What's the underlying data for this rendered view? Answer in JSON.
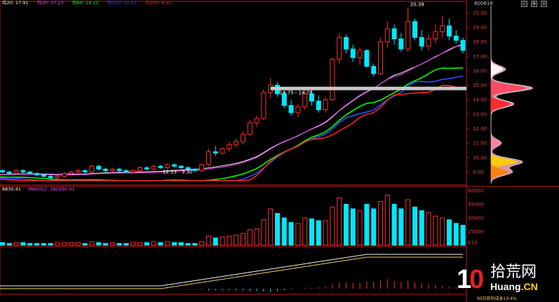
{
  "stock_code": "600618",
  "cost_label": "90日获利成本19.4%",
  "watermark": {
    "num_left": "1",
    "num_right": "0",
    "cn": "拾荒网",
    "url_main": "Huang",
    "url_suffix": ".CN"
  },
  "toolbar_icons": [
    "search-icon",
    "settings-icon",
    "close-icon"
  ],
  "colors": {
    "up": "#ff3030",
    "down": "#00e8ff",
    "grid": "#5a0000",
    "axis": "#c01818"
  },
  "price_panel": {
    "ma_legend": [
      {
        "label": "均20: 17.91",
        "color": "#f0f0f0"
      },
      {
        "label": "均30: 17.23",
        "color": "#ff40ff"
      },
      {
        "label": "均60: 14.12",
        "color": "#00ff00"
      },
      {
        "label": "均120: 11.11",
        "color": "#3050ff"
      },
      {
        "label": "均200: 9.91",
        "color": "#ff2020"
      }
    ],
    "y_ticks": [
      "20.00",
      "19.00",
      "18.00",
      "17.00",
      "16.00",
      "15.00",
      "14.00",
      "13.00",
      "12.00",
      "11.00",
      "10.00",
      "9.00"
    ],
    "annotations": [
      {
        "text": "20.39",
        "price": 20.39
      },
      {
        "text": "14.75 - 14.76",
        "price": 14.75
      },
      {
        "text": "12.13 - 9.30",
        "price": 9.3
      }
    ]
  },
  "volume_panel": {
    "legend": [
      {
        "label": "8830.41",
        "color": "#ffffff"
      },
      {
        "label": "MAVOL2: 280290.41",
        "color": "#ff40ff"
      }
    ],
    "y_ticks": [
      "60000",
      "45000",
      "30000",
      "15000",
      "X10"
    ]
  },
  "chart_data": {
    "type": "candlestick",
    "ylim": [
      8.2,
      20.5
    ],
    "candles": [
      [
        8.6,
        8.9,
        8.5,
        8.8
      ],
      [
        8.8,
        8.9,
        8.6,
        8.7
      ],
      [
        8.7,
        8.8,
        8.5,
        8.6
      ],
      [
        8.6,
        8.9,
        8.5,
        8.8
      ],
      [
        8.8,
        8.9,
        8.6,
        8.7
      ],
      [
        8.7,
        9.0,
        8.6,
        8.9
      ],
      [
        8.9,
        9.3,
        8.8,
        9.1
      ],
      [
        9.1,
        9.2,
        8.9,
        9.0
      ],
      [
        9.0,
        9.1,
        8.8,
        8.9
      ],
      [
        8.9,
        9.2,
        8.8,
        9.1
      ],
      [
        9.1,
        9.2,
        8.9,
        9.0
      ],
      [
        9.0,
        9.1,
        8.8,
        8.9
      ],
      [
        8.9,
        9.0,
        8.7,
        8.8
      ],
      [
        8.8,
        8.9,
        8.6,
        8.7
      ],
      [
        8.7,
        8.8,
        8.5,
        8.6
      ],
      [
        8.6,
        8.8,
        8.5,
        8.7
      ],
      [
        8.7,
        9.0,
        8.6,
        8.9
      ],
      [
        8.9,
        9.1,
        8.8,
        9.0
      ],
      [
        9.0,
        9.2,
        8.9,
        9.1
      ],
      [
        9.1,
        9.2,
        8.9,
        9.0
      ],
      [
        9.0,
        9.5,
        8.9,
        9.4
      ],
      [
        9.4,
        9.5,
        9.1,
        9.2
      ],
      [
        9.2,
        9.3,
        9.0,
        9.1
      ],
      [
        9.1,
        9.3,
        9.0,
        9.2
      ],
      [
        9.2,
        9.3,
        9.0,
        9.1
      ],
      [
        9.1,
        9.2,
        8.9,
        9.0
      ],
      [
        9.0,
        9.2,
        8.9,
        9.1
      ],
      [
        9.1,
        9.4,
        9.0,
        9.3
      ],
      [
        9.3,
        9.4,
        9.1,
        9.2
      ],
      [
        9.2,
        9.5,
        9.1,
        9.4
      ],
      [
        9.4,
        9.5,
        9.2,
        9.3
      ],
      [
        9.3,
        9.6,
        9.2,
        9.5
      ],
      [
        9.5,
        9.6,
        9.3,
        9.4
      ],
      [
        9.4,
        9.5,
        9.2,
        9.3
      ],
      [
        9.3,
        9.4,
        9.1,
        9.2
      ],
      [
        9.2,
        9.3,
        9.0,
        9.1
      ],
      [
        9.1,
        9.6,
        9.0,
        9.5
      ],
      [
        9.5,
        10.6,
        9.4,
        10.4
      ],
      [
        10.4,
        10.8,
        10.1,
        10.3
      ],
      [
        10.3,
        10.7,
        10.2,
        10.6
      ],
      [
        10.6,
        11.1,
        10.4,
        10.9
      ],
      [
        10.9,
        11.3,
        10.7,
        11.1
      ],
      [
        11.1,
        11.8,
        10.9,
        11.6
      ],
      [
        11.6,
        12.6,
        11.5,
        12.4
      ],
      [
        12.4,
        12.9,
        12.1,
        12.7
      ],
      [
        12.7,
        14.7,
        12.6,
        14.5
      ],
      [
        14.5,
        15.5,
        14.1,
        15.0
      ],
      [
        15.0,
        15.2,
        14.2,
        14.4
      ],
      [
        14.4,
        14.6,
        13.4,
        13.6
      ],
      [
        13.6,
        14.0,
        12.9,
        13.1
      ],
      [
        13.1,
        13.7,
        12.8,
        13.5
      ],
      [
        13.5,
        14.7,
        13.3,
        14.4
      ],
      [
        14.4,
        14.8,
        13.6,
        13.9
      ],
      [
        13.9,
        14.3,
        13.1,
        13.3
      ],
      [
        13.3,
        14.2,
        13.1,
        14.0
      ],
      [
        14.0,
        16.9,
        13.9,
        16.8
      ],
      [
        16.8,
        18.6,
        16.5,
        18.3
      ],
      [
        18.3,
        18.5,
        17.2,
        17.5
      ],
      [
        17.5,
        17.8,
        16.6,
        16.9
      ],
      [
        16.9,
        17.6,
        16.4,
        17.4
      ],
      [
        17.4,
        17.5,
        16.2,
        16.3
      ],
      [
        16.3,
        16.5,
        15.6,
        15.8
      ],
      [
        15.8,
        18.3,
        15.7,
        18.0
      ],
      [
        18.0,
        19.4,
        17.6,
        18.9
      ],
      [
        18.9,
        19.2,
        17.8,
        18.2
      ],
      [
        18.2,
        18.6,
        17.3,
        17.5
      ],
      [
        17.5,
        20.39,
        17.3,
        19.4
      ],
      [
        19.4,
        19.6,
        18.1,
        18.3
      ],
      [
        18.3,
        18.8,
        17.4,
        17.7
      ],
      [
        17.7,
        18.5,
        17.4,
        18.2
      ],
      [
        18.2,
        19.2,
        17.9,
        18.7
      ],
      [
        18.7,
        19.8,
        18.3,
        19.1
      ],
      [
        19.1,
        19.6,
        18.1,
        18.4
      ],
      [
        18.4,
        18.8,
        17.9,
        18.1
      ],
      [
        18.1,
        18.3,
        17.2,
        17.4
      ]
    ],
    "volumes": [
      2,
      3,
      2,
      3,
      2,
      3,
      4,
      3,
      2,
      3,
      3,
      2,
      2,
      2,
      2,
      3,
      3,
      3,
      3,
      2,
      4,
      3,
      2,
      3,
      2,
      2,
      3,
      3,
      3,
      4,
      3,
      4,
      3,
      3,
      2,
      2,
      4,
      10,
      8,
      9,
      10,
      11,
      13,
      17,
      18,
      28,
      40,
      35,
      30,
      25,
      24,
      30,
      29,
      27,
      27,
      42,
      52,
      45,
      40,
      38,
      45,
      40,
      48,
      55,
      45,
      40,
      50,
      42,
      38,
      36,
      32,
      30,
      28,
      24,
      22
    ],
    "ma_lines": [
      {
        "name": "均20",
        "color": "#f0f0f0",
        "period": 20
      },
      {
        "name": "均30",
        "color": "#ff40ff",
        "period": 30
      },
      {
        "name": "均60",
        "color": "#00ff00",
        "period": 60
      },
      {
        "name": "均120",
        "color": "#3050ff",
        "period": 120
      },
      {
        "name": "均200",
        "color": "#ff2020",
        "period": 200
      }
    ],
    "chip_peaks": [
      {
        "price": 14.8,
        "strength": 1.0,
        "color": "#ff4060"
      },
      {
        "price": 13.7,
        "strength": 0.55,
        "color": "#ff2020"
      },
      {
        "price": 16.1,
        "strength": 0.35,
        "color": "#ffffff"
      },
      {
        "price": 9.7,
        "strength": 0.75,
        "color": "#ffd000"
      },
      {
        "price": 9.0,
        "strength": 0.5,
        "color": "#ff8000"
      },
      {
        "price": 11.0,
        "strength": 0.25,
        "color": "#ff80a0"
      }
    ]
  }
}
